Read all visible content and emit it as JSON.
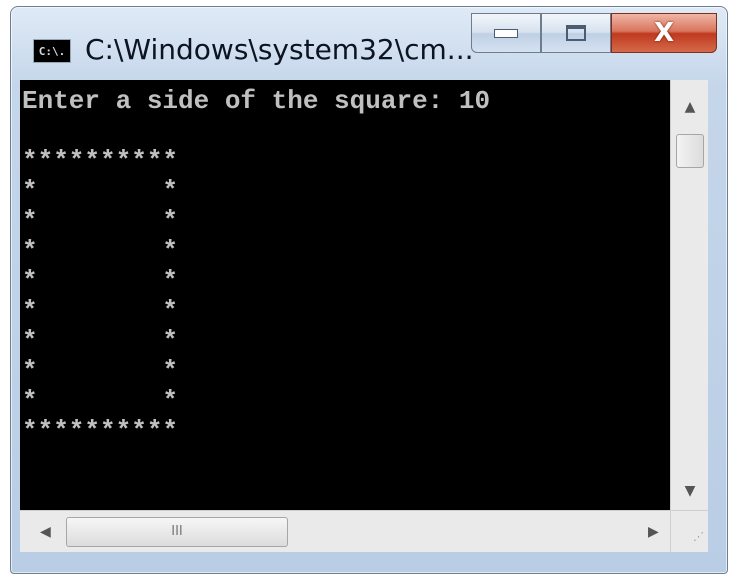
{
  "window": {
    "title": "C:\\Windows\\system32\\cm...",
    "icon_label": "C:\\.",
    "buttons": {
      "minimize_icon": "minimize-icon",
      "maximize_icon": "maximize-icon",
      "close_label": "X"
    }
  },
  "console": {
    "prompt_line": "Enter a side of the square: 10",
    "output_lines": [
      "",
      "**********",
      "*        *",
      "*        *",
      "*        *",
      "*        *",
      "*        *",
      "*        *",
      "*        *",
      "*        *",
      "**********"
    ],
    "colors": {
      "background": "#000000",
      "text": "#c0c0c0"
    }
  },
  "scrollbars": {
    "vertical": {
      "up_icon": "arrow-up-icon",
      "down_icon": "arrow-down-icon"
    },
    "horizontal": {
      "left_icon": "arrow-left-icon",
      "right_icon": "arrow-right-icon",
      "thumb_grip": "III"
    }
  },
  "colors": {
    "close_button": "#c0391f",
    "frame": "#b9cde5"
  }
}
